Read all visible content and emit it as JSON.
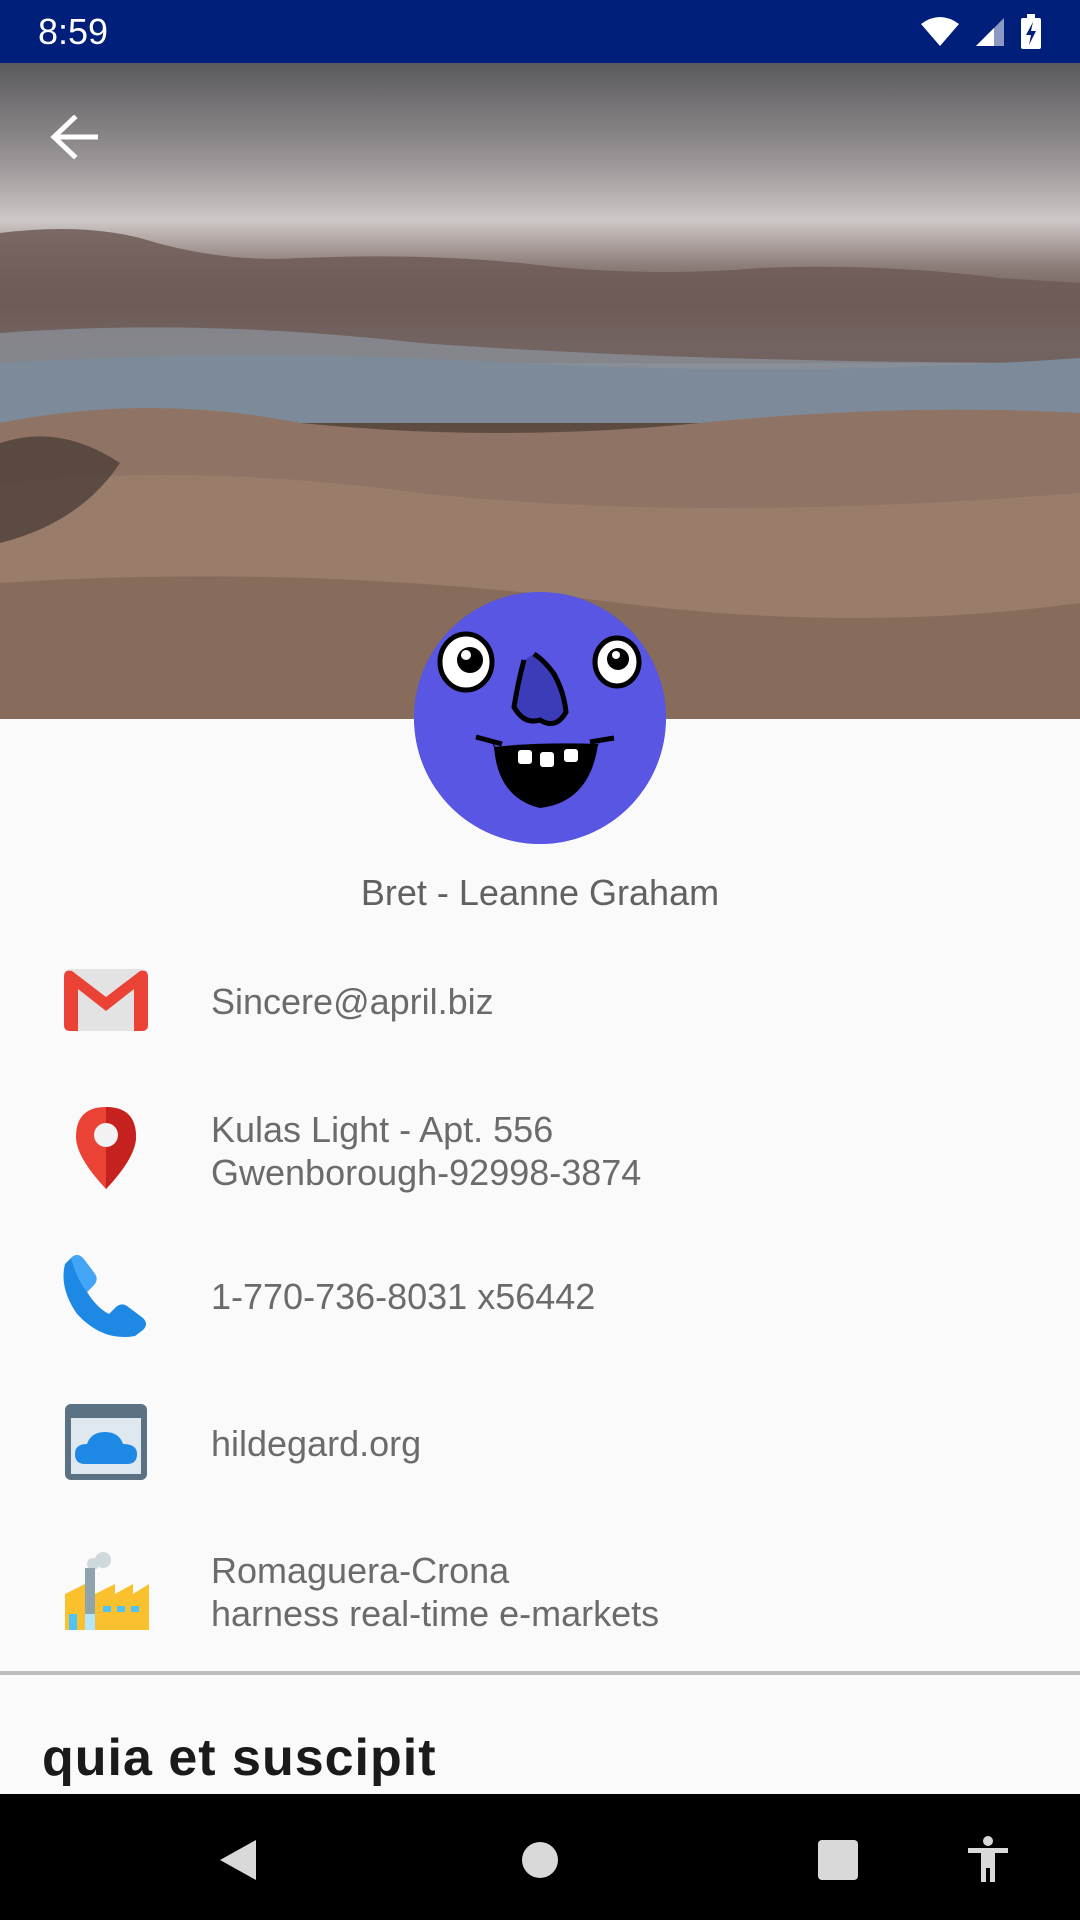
{
  "status_bar": {
    "time": "8:59",
    "icons": [
      "wifi-icon",
      "cell-signal-icon",
      "battery-charging-icon"
    ]
  },
  "header": {
    "back_icon": "arrow-back-icon",
    "photo": "landscape-lake-hills"
  },
  "avatar": {
    "icon": "cartoon-face-avatar",
    "color": "#5856e2"
  },
  "user": {
    "name": "Bret - Leanne Graham"
  },
  "details": {
    "email": "Sincere@april.biz",
    "address_line1": "Kulas Light - Apt. 556",
    "address_line2": "Gwenborough-92998-3874",
    "phone": "1-770-736-8031 x56442",
    "website": "hildegard.org",
    "company_name": "Romaguera-Crona",
    "company_catchphrase": "harness real-time e-markets"
  },
  "section": {
    "title": "quia et suscipit"
  },
  "nav": {
    "icons": [
      "back-triangle-icon",
      "home-circle-icon",
      "recents-square-icon",
      "accessibility-icon"
    ]
  },
  "colors": {
    "status_bar": "#001f7a",
    "avatar": "#5856e2",
    "email_red": "#ea4335",
    "phone_blue": "#1e88e5"
  }
}
